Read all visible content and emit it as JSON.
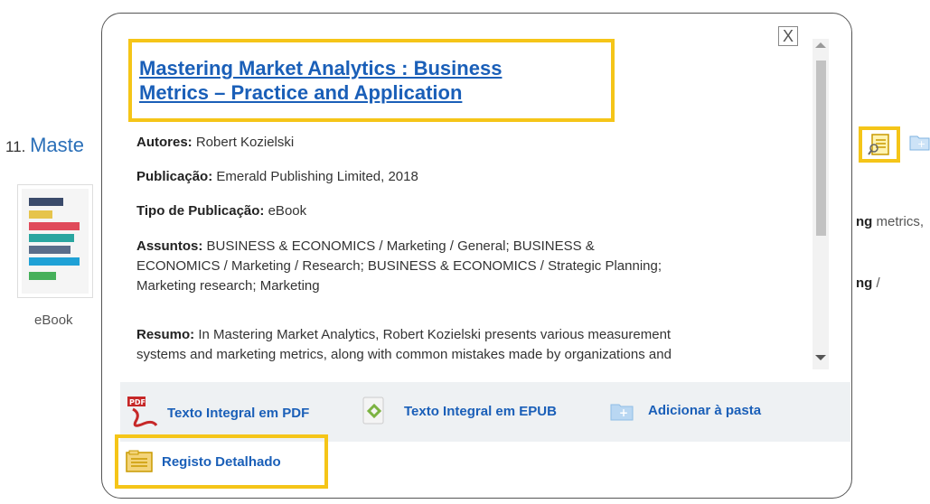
{
  "background": {
    "result_number": "11.",
    "result_title_partial": "Maste",
    "cover_label": "eBook",
    "snippet_1_bold": "ng",
    "snippet_1_rest": " metrics,",
    "snippet_2_bold": "ng",
    "snippet_2_rest": " /"
  },
  "popup": {
    "close_label": "X",
    "title_line1": "Mastering Market Analytics : Business",
    "title_line2": "Metrics – Practice and Application",
    "fields": {
      "authors_label": "Autores:",
      "authors_value": "Robert Kozielski",
      "publication_label": "Publicação:",
      "publication_value": "Emerald Publishing Limited, 2018",
      "type_label": "Tipo de Publicação:",
      "type_value": "eBook",
      "subjects_label": "Assuntos:",
      "subjects_line1": "BUSINESS & ECONOMICS / Marketing / General; BUSINESS &",
      "subjects_line2": "ECONOMICS / Marketing / Research; BUSINESS & ECONOMICS / Strategic Planning;",
      "subjects_line3": "Marketing research; Marketing",
      "abstract_label": "Resumo:",
      "abstract_line1": "In Mastering Market Analytics, Robert Kozielski presents various measurement",
      "abstract_line2": "systems and marketing metrics, along with common mistakes made by organizations and"
    },
    "links": {
      "pdf": "Texto Integral em PDF",
      "epub": "Texto Integral em EPUB",
      "add_folder": "Adicionar à pasta",
      "detailed": "Registo Detalhado"
    },
    "icons": {
      "pdf_badge": "PDF"
    }
  },
  "colors": {
    "highlight": "#f5c518",
    "link": "#1a5fb8"
  }
}
